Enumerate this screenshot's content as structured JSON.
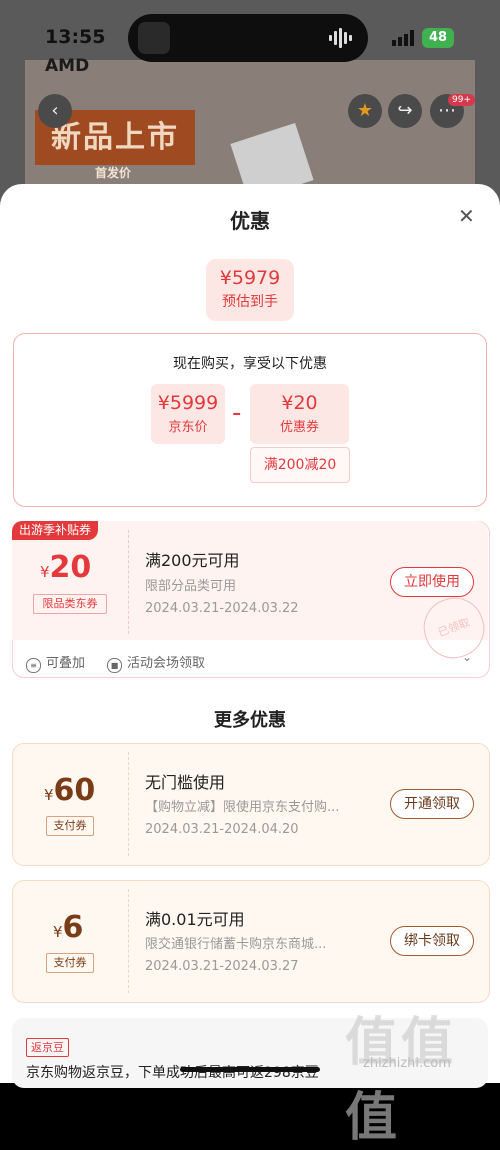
{
  "status_bar": {
    "time": "13:55",
    "battery": "48"
  },
  "background": {
    "brand": "AMD",
    "promo": "新品上市",
    "promo_sub": "首发价",
    "badge": "99+"
  },
  "sheet": {
    "title": "优惠",
    "estimate": {
      "price": "¥5979",
      "label": "预估到手"
    },
    "breakdown": {
      "header": "现在购买，享受以下优惠",
      "jd_price": {
        "price": "¥5999",
        "label": "京东价"
      },
      "operator": "-",
      "coupon": {
        "price": "¥20",
        "label": "优惠券"
      },
      "coupon_rule": "满200减20"
    },
    "coupon_main": {
      "ribbon": "出游季补贴券",
      "currency": "¥",
      "amount": "20",
      "type": "限品类东券",
      "title": "满200元可用",
      "subtitle": "限部分品类可用",
      "date": "2024.03.21-2024.03.22",
      "button": "立即使用",
      "stamp": "已领取",
      "foot_stackable": "可叠加",
      "foot_source": "活动会场领取"
    },
    "more_title": "更多优惠",
    "more_coupons": [
      {
        "currency": "¥",
        "amount": "60",
        "type": "支付券",
        "title": "无门槛使用",
        "subtitle": "【购物立减】限使用京东支付购...",
        "date": "2024.03.21-2024.04.20",
        "button": "开通领取"
      },
      {
        "currency": "¥",
        "amount": "6",
        "type": "支付券",
        "title": "满0.01元可用",
        "subtitle": "限交通银行储蓄卡购京东商城...",
        "date": "2024.03.21-2024.03.27",
        "button": "绑卡领取"
      }
    ],
    "jingdou": {
      "tag": "返京豆",
      "text": "京东购物返京豆，下单成功后最高可返298京豆"
    }
  },
  "watermark": {
    "logo": "值值值",
    "url": "zhizhizhi.com"
  }
}
